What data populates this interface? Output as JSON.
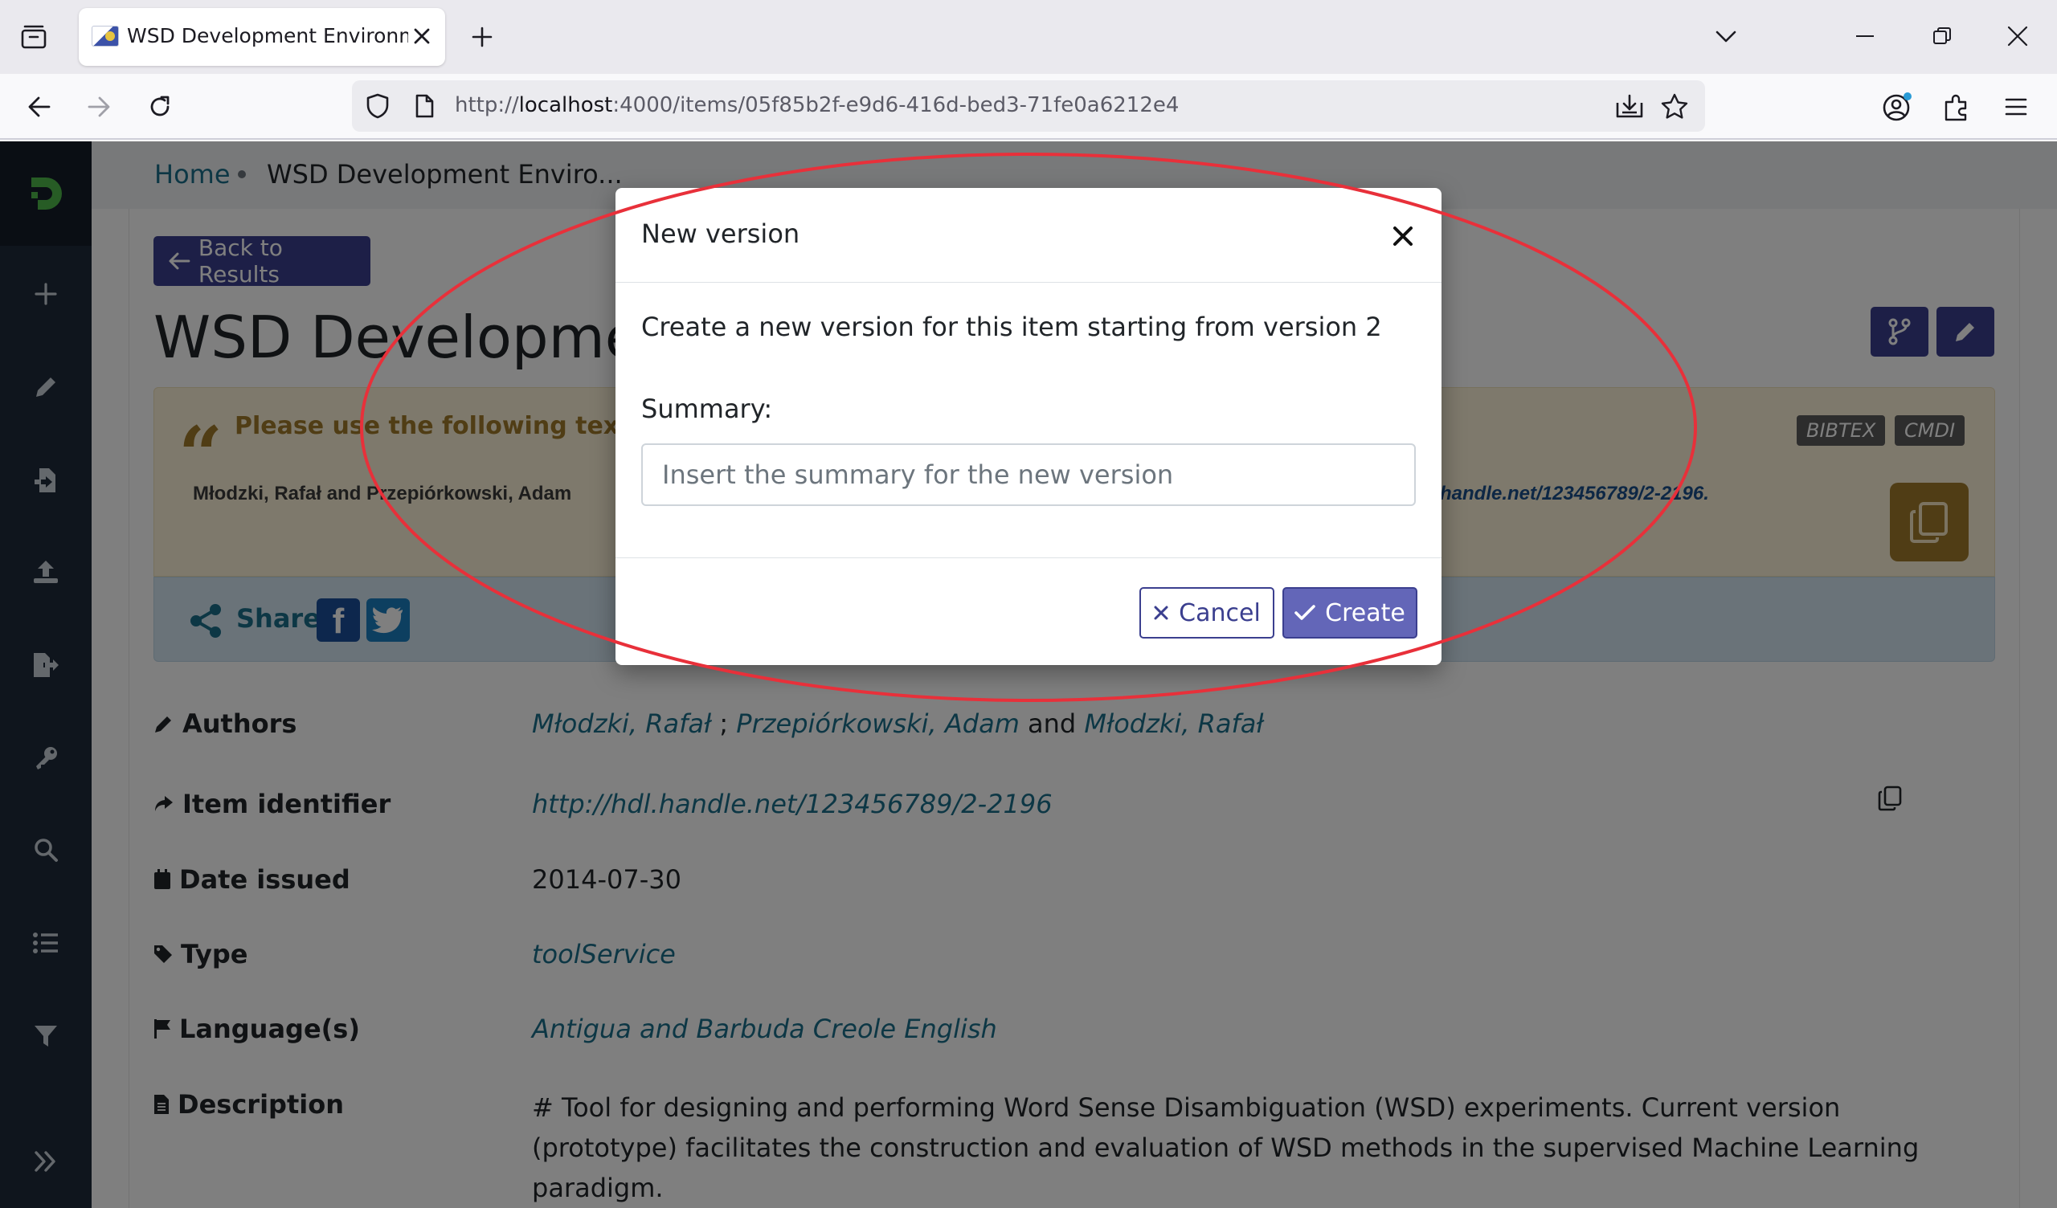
{
  "browser": {
    "tab_title": "WSD Development Environment",
    "url_prefix": "http://",
    "url_host": "localhost",
    "url_rest": ":4000/items/05f85b2f-e9d6-416d-bed3-71fe0a6212e4"
  },
  "breadcrumb": {
    "home": "Home",
    "current": "WSD Development Enviro..."
  },
  "page": {
    "back_label": "Back to Results",
    "title": "WSD Developmen"
  },
  "citation": {
    "heading": "Please use the following text t",
    "text": "Młodzki, Rafał and Przepiórkowski, Adam",
    "link_text": "handle.net/123456789/2-2196.",
    "badge_bibtex": "BIBTEX",
    "badge_cmdi": "CMDI"
  },
  "share": {
    "label": "Share"
  },
  "metadata": {
    "authors_label": "Authors",
    "author_1": "Młodzki, Rafał",
    "sep_1": ";",
    "author_2": "Przepiórkowski, Adam",
    "sep_2": "and",
    "author_3": "Młodzki, Rafał",
    "identifier_label": "Item identifier",
    "identifier_value": "http://hdl.handle.net/123456789/2-2196",
    "date_label": "Date issued",
    "date_value": "2014-07-30",
    "type_label": "Type",
    "type_value": "toolService",
    "language_label": "Language(s)",
    "language_value": "Antigua and Barbuda Creole English",
    "description_label": "Description",
    "description_value": "# Tool for designing and performing Word Sense Disambiguation (WSD) experiments. Current version (prototype) facilitates the construction and evaluation of WSD methods in the supervised Machine Learning paradigm."
  },
  "modal": {
    "title": "New version",
    "body_text": "Create a new version for this item starting from version 2",
    "summary_label": "Summary:",
    "summary_placeholder": "Insert the summary for the new version",
    "summary_value": "",
    "cancel_label": "Cancel",
    "create_label": "Create"
  },
  "colors": {
    "primary": "#3b3f8f",
    "sidebar": "#1f2b3a",
    "link": "#1a6f8a",
    "annotation": "#e8303a"
  }
}
